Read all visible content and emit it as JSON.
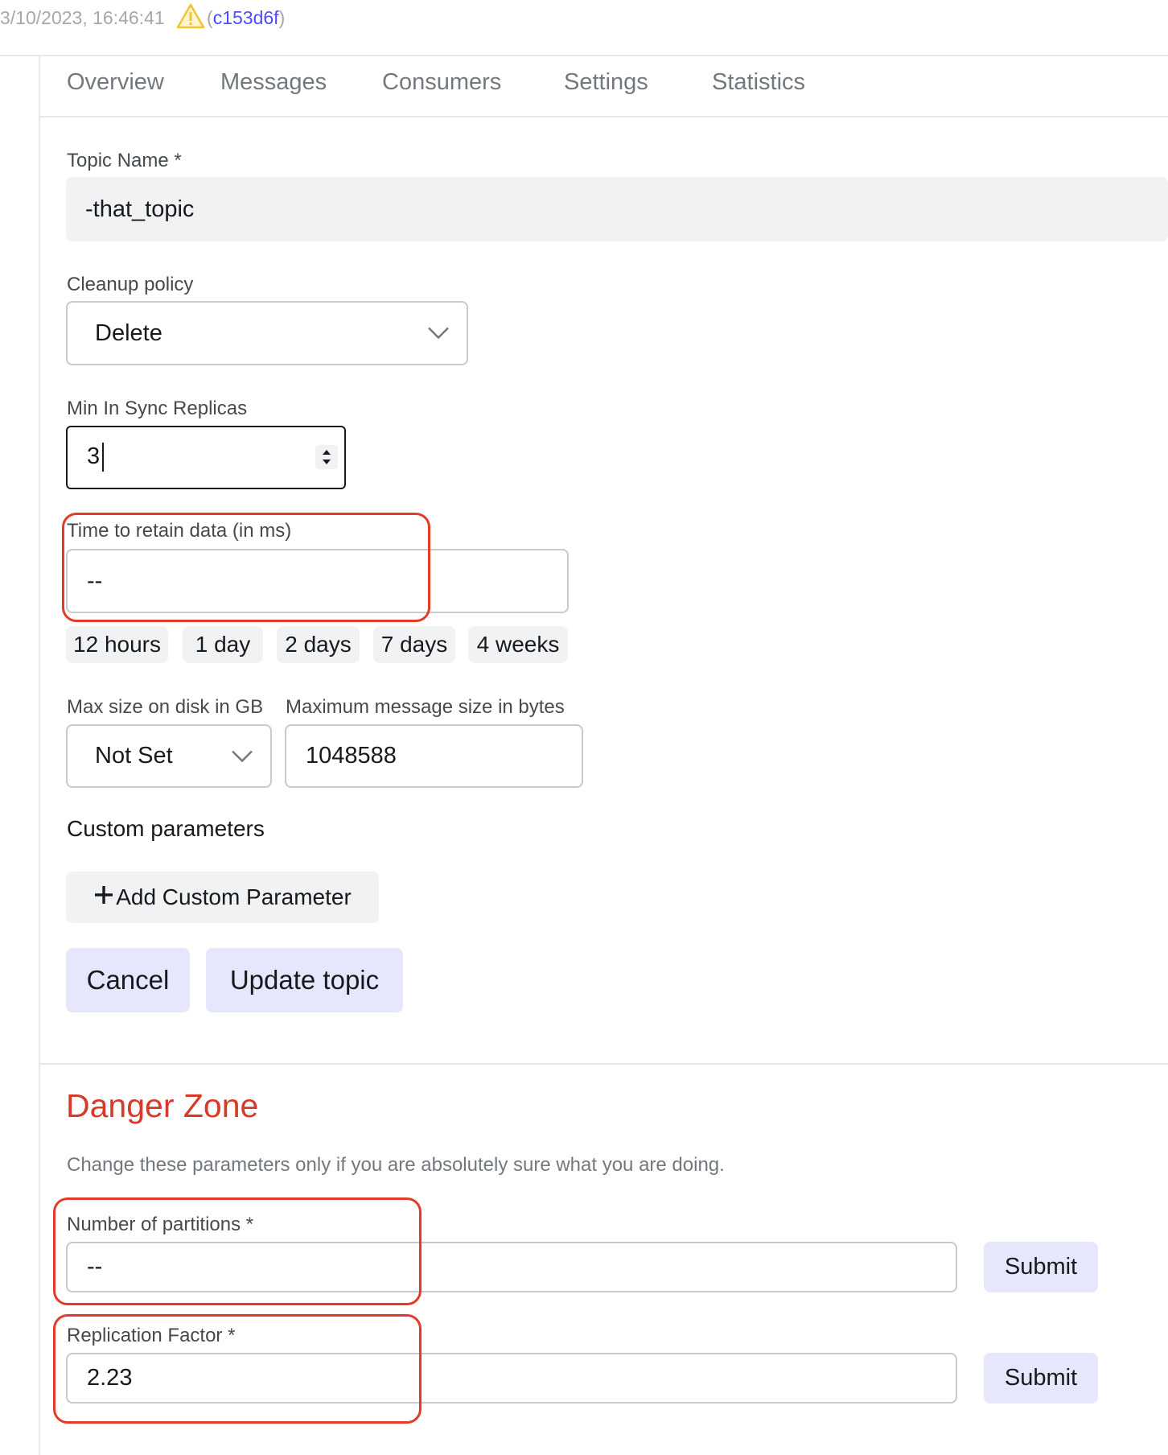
{
  "header": {
    "timestamp": "3/10/2023, 16:46:41",
    "paren_open": "(",
    "commit": "c153d6f",
    "paren_close": ")"
  },
  "tabs": [
    "Overview",
    "Messages",
    "Consumers",
    "Settings",
    "Statistics"
  ],
  "form": {
    "topic_name": {
      "label": "Topic Name *",
      "value": "-that_topic"
    },
    "cleanup_policy": {
      "label": "Cleanup policy",
      "value": "Delete"
    },
    "min_in_sync": {
      "label": "Min In Sync Replicas",
      "value": "3"
    },
    "retention": {
      "label": "Time to retain data (in ms)",
      "value": "--",
      "presets": [
        "12 hours",
        "1 day",
        "2 days",
        "7 days",
        "4 weeks"
      ]
    },
    "max_size": {
      "label": "Max size on disk in GB",
      "value": "Not Set"
    },
    "max_message_size": {
      "label": "Maximum message size in bytes",
      "value": "1048588"
    },
    "custom_params": {
      "heading": "Custom parameters",
      "add_button": "Add Custom Parameter"
    },
    "cancel_button": "Cancel",
    "update_button": "Update topic"
  },
  "danger_zone": {
    "title": "Danger Zone",
    "description": "Change these parameters only if you are absolutely sure what you are doing.",
    "partitions": {
      "label": "Number of partitions *",
      "value": "--",
      "submit": "Submit"
    },
    "replication": {
      "label": "Replication Factor *",
      "value": "2.23",
      "submit": "Submit"
    }
  },
  "colors": {
    "danger": "#d63a2a",
    "highlight_outline": "#e23c28",
    "button_bg": "#e6e6fc",
    "commit_link": "#4c4cff",
    "warning": "#f2c23a"
  },
  "icons": [
    "warning-icon",
    "chevron-down-icon",
    "stepper-icon",
    "plus-icon"
  ]
}
